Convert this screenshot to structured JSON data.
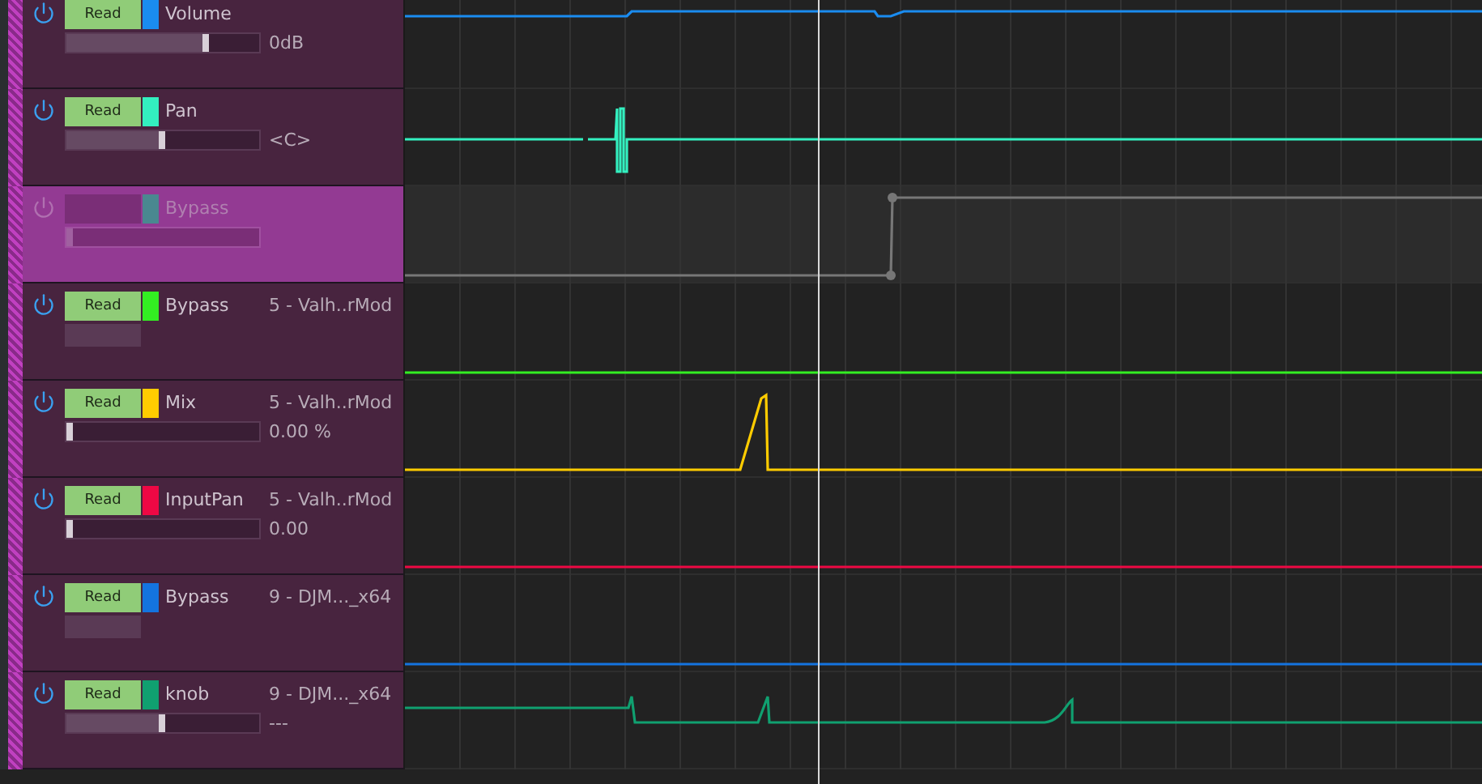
{
  "tracks": [
    {
      "name": "Volume",
      "enabled": true,
      "selected": false,
      "mode": "Read",
      "color": "#1a8cf0",
      "control": {
        "kind": "slider",
        "level": 0.74
      },
      "value": "0dB"
    },
    {
      "name": "Pan",
      "enabled": true,
      "selected": false,
      "mode": "Read",
      "color": "#33f0c0",
      "control": {
        "kind": "slider",
        "level": 0.5
      },
      "value": "<C>"
    },
    {
      "name": "Bypass",
      "enabled": false,
      "selected": true,
      "color": "#4a8890",
      "control": {
        "kind": "slider",
        "level": 0.0
      }
    },
    {
      "name": "Bypass",
      "enabled": true,
      "selected": false,
      "mode": "Read",
      "color": "#33ee22",
      "plugin": "5 - Valh..rMod",
      "control": {
        "kind": "toggle"
      }
    },
    {
      "name": "Mix",
      "enabled": true,
      "selected": false,
      "mode": "Read",
      "color": "#ffcc00",
      "plugin": "5 - Valh..rMod",
      "control": {
        "kind": "slider",
        "level": 0.0
      },
      "value": "0.00 %"
    },
    {
      "name": "InputPan",
      "enabled": true,
      "selected": false,
      "mode": "Read",
      "color": "#ee0844",
      "plugin": "5 - Valh..rMod",
      "control": {
        "kind": "slider",
        "level": 0.0
      },
      "value": "0.00"
    },
    {
      "name": "Bypass",
      "enabled": true,
      "selected": false,
      "mode": "Read",
      "color": "#1474e0",
      "plugin": "9 - DJM..._x64",
      "control": {
        "kind": "toggle"
      }
    },
    {
      "name": "knob",
      "enabled": true,
      "selected": false,
      "mode": "Read",
      "color": "#10a070",
      "plugin": "9 - DJM..._x64",
      "control": {
        "kind": "slider",
        "level": 0.5
      },
      "value": "---"
    }
  ]
}
